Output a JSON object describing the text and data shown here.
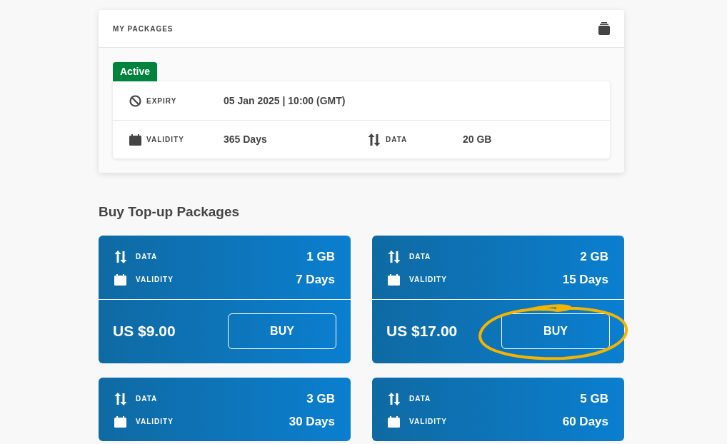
{
  "my_packages": {
    "title": "MY PACKAGES",
    "status": "Active",
    "expiry_label": "EXPIRY",
    "expiry_value": "05 Jan 2025 | 10:00 (GMT)",
    "validity_label": "VALIDITY",
    "validity_value": "365 Days",
    "data_label": "DATA",
    "data_value": "20 GB"
  },
  "topup": {
    "heading": "Buy Top-up Packages",
    "packages": [
      {
        "data_label": "DATA",
        "data": "1 GB",
        "validity_label": "VALIDITY",
        "validity": "7 Days",
        "price": "US $9.00",
        "button": "BUY",
        "highlighted": false
      },
      {
        "data_label": "DATA",
        "data": "2 GB",
        "validity_label": "VALIDITY",
        "validity": "15 Days",
        "price": "US $17.00",
        "button": "BUY",
        "highlighted": true
      },
      {
        "data_label": "DATA",
        "data": "3 GB",
        "validity_label": "VALIDITY",
        "validity": "30 Days"
      },
      {
        "data_label": "DATA",
        "data": "5 GB",
        "validity_label": "VALIDITY",
        "validity": "60 Days"
      }
    ]
  }
}
